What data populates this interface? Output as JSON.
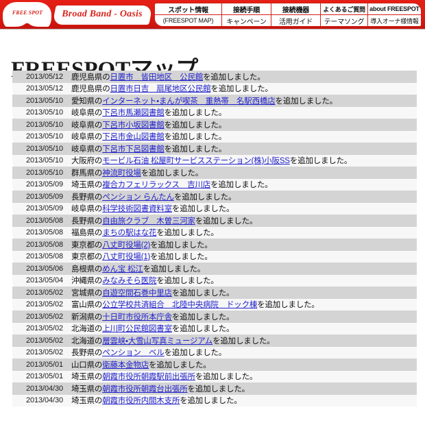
{
  "header": {
    "logo_text": "FREE SPOT",
    "tagline": "Broad Band - Oasis",
    "nav": [
      {
        "top": "スポット情報",
        "bottom": "(FREESPOT MAP)"
      },
      {
        "top": "接続手順",
        "bottom": "キャンペーン"
      },
      {
        "top": "接続機器",
        "bottom": "活用ガイド"
      },
      {
        "top": "よくあるご質問",
        "bottom": "テーマソング"
      },
      {
        "top": "about FREESPOT",
        "bottom": "導入オーナ様情報"
      }
    ]
  },
  "page_title": "FREESPOTマップ",
  "list": {
    "rows": [
      {
        "date": "2013/05/12",
        "pre": "鹿児島県の",
        "link": "日置市　皆田地区　公民館",
        "post": "を追加しました。"
      },
      {
        "date": "2013/05/12",
        "pre": "鹿児島県の",
        "link": "日置市日吉　扇尾地区公民館",
        "post": "を追加しました。"
      },
      {
        "date": "2013/05/10",
        "pre": "愛知県の",
        "link": "インターネット・まんが喫茶　重熱帯　名駅西橋店",
        "post": "を追加しました。"
      },
      {
        "date": "2013/05/10",
        "pre": "岐阜県の",
        "link": "下呂市馬瀬図書館",
        "post": "を追加しました。"
      },
      {
        "date": "2013/05/10",
        "pre": "岐阜県の",
        "link": "下呂市小坂図書館",
        "post": "を追加しました。"
      },
      {
        "date": "2013/05/10",
        "pre": "岐阜県の",
        "link": "下呂市金山図書館",
        "post": "を追加しました。"
      },
      {
        "date": "2013/05/10",
        "pre": "岐阜県の",
        "link": "下呂市下呂図書館",
        "post": "を追加しました。"
      },
      {
        "date": "2013/05/10",
        "pre": "大阪府の",
        "link": "モービル石油 松屋町サービスステーション(株)小阪SS",
        "post": "を追加しました。"
      },
      {
        "date": "2013/05/10",
        "pre": "群馬県の",
        "link": "神流町役場",
        "post": "を追加しました。"
      },
      {
        "date": "2013/05/09",
        "pre": "埼玉県の",
        "link": "複合カフェリラックス　吉川店",
        "post": "を追加しました。"
      },
      {
        "date": "2013/05/09",
        "pre": "長野県の",
        "link": "ペンション らんたん",
        "post": "を追加しました。"
      },
      {
        "date": "2013/05/09",
        "pre": "岐阜県の",
        "link": "科学技術図書資料室",
        "post": "を追加しました。"
      },
      {
        "date": "2013/05/08",
        "pre": "長野県の",
        "link": "自由旅クラブ　木曽三河家",
        "post": "を追加しました。"
      },
      {
        "date": "2013/05/08",
        "pre": "福島県の",
        "link": "まちの駅はな花",
        "post": "を追加しました。"
      },
      {
        "date": "2013/05/08",
        "pre": "東京都の",
        "link": "八丈町役場(2)",
        "post": "を追加しました。"
      },
      {
        "date": "2013/05/08",
        "pre": "東京都の",
        "link": "八丈町役場(1)",
        "post": "を追加しました。"
      },
      {
        "date": "2013/05/06",
        "pre": "島根県の",
        "link": "めん宝 松江",
        "post": "を追加しました。"
      },
      {
        "date": "2013/05/04",
        "pre": "沖縄県の",
        "link": "みなみそら医院",
        "post": "を追加しました。"
      },
      {
        "date": "2013/05/02",
        "pre": "宮城県の",
        "link": "自遊空間石巻中里店",
        "post": "を追加しました。"
      },
      {
        "date": "2013/05/02",
        "pre": "富山県の",
        "link": "公立学校共済組合　北陸中央病院　ドック棟",
        "post": "を追加しました。"
      },
      {
        "date": "2013/05/02",
        "pre": "新潟県の",
        "link": "十日町市役所本庁舎",
        "post": "を追加しました。"
      },
      {
        "date": "2013/05/02",
        "pre": "北海道の",
        "link": "上川町公民館図書室",
        "post": "を追加しました。"
      },
      {
        "date": "2013/05/02",
        "pre": "北海道の",
        "link": "層雲峡・大雪山写真ミュージアム",
        "post": "を追加しました。"
      },
      {
        "date": "2013/05/02",
        "pre": "長野県の",
        "link": "ペンション　ベル",
        "post": "を追加しました。"
      },
      {
        "date": "2013/05/01",
        "pre": "山口県の",
        "link": "衛藤本金物店",
        "post": "を追加しました。"
      },
      {
        "date": "2013/05/01",
        "pre": "埼玉県の",
        "link": "朝霞市役所朝霞駅前出張所",
        "post": "を追加しました。"
      },
      {
        "date": "2013/04/30",
        "pre": "埼玉県の",
        "link": "朝霞市役所朝霞台出張所",
        "post": "を追加しました。"
      },
      {
        "date": "2013/04/30",
        "pre": "埼玉県の",
        "link": "朝霞市役所内間木支所",
        "post": "を追加しました。"
      }
    ]
  },
  "colors": {
    "brand_red": "#d8231a",
    "link_blue": "#2222cc",
    "row_odd": "#d4d4d4",
    "row_even": "#f7f7f7"
  }
}
